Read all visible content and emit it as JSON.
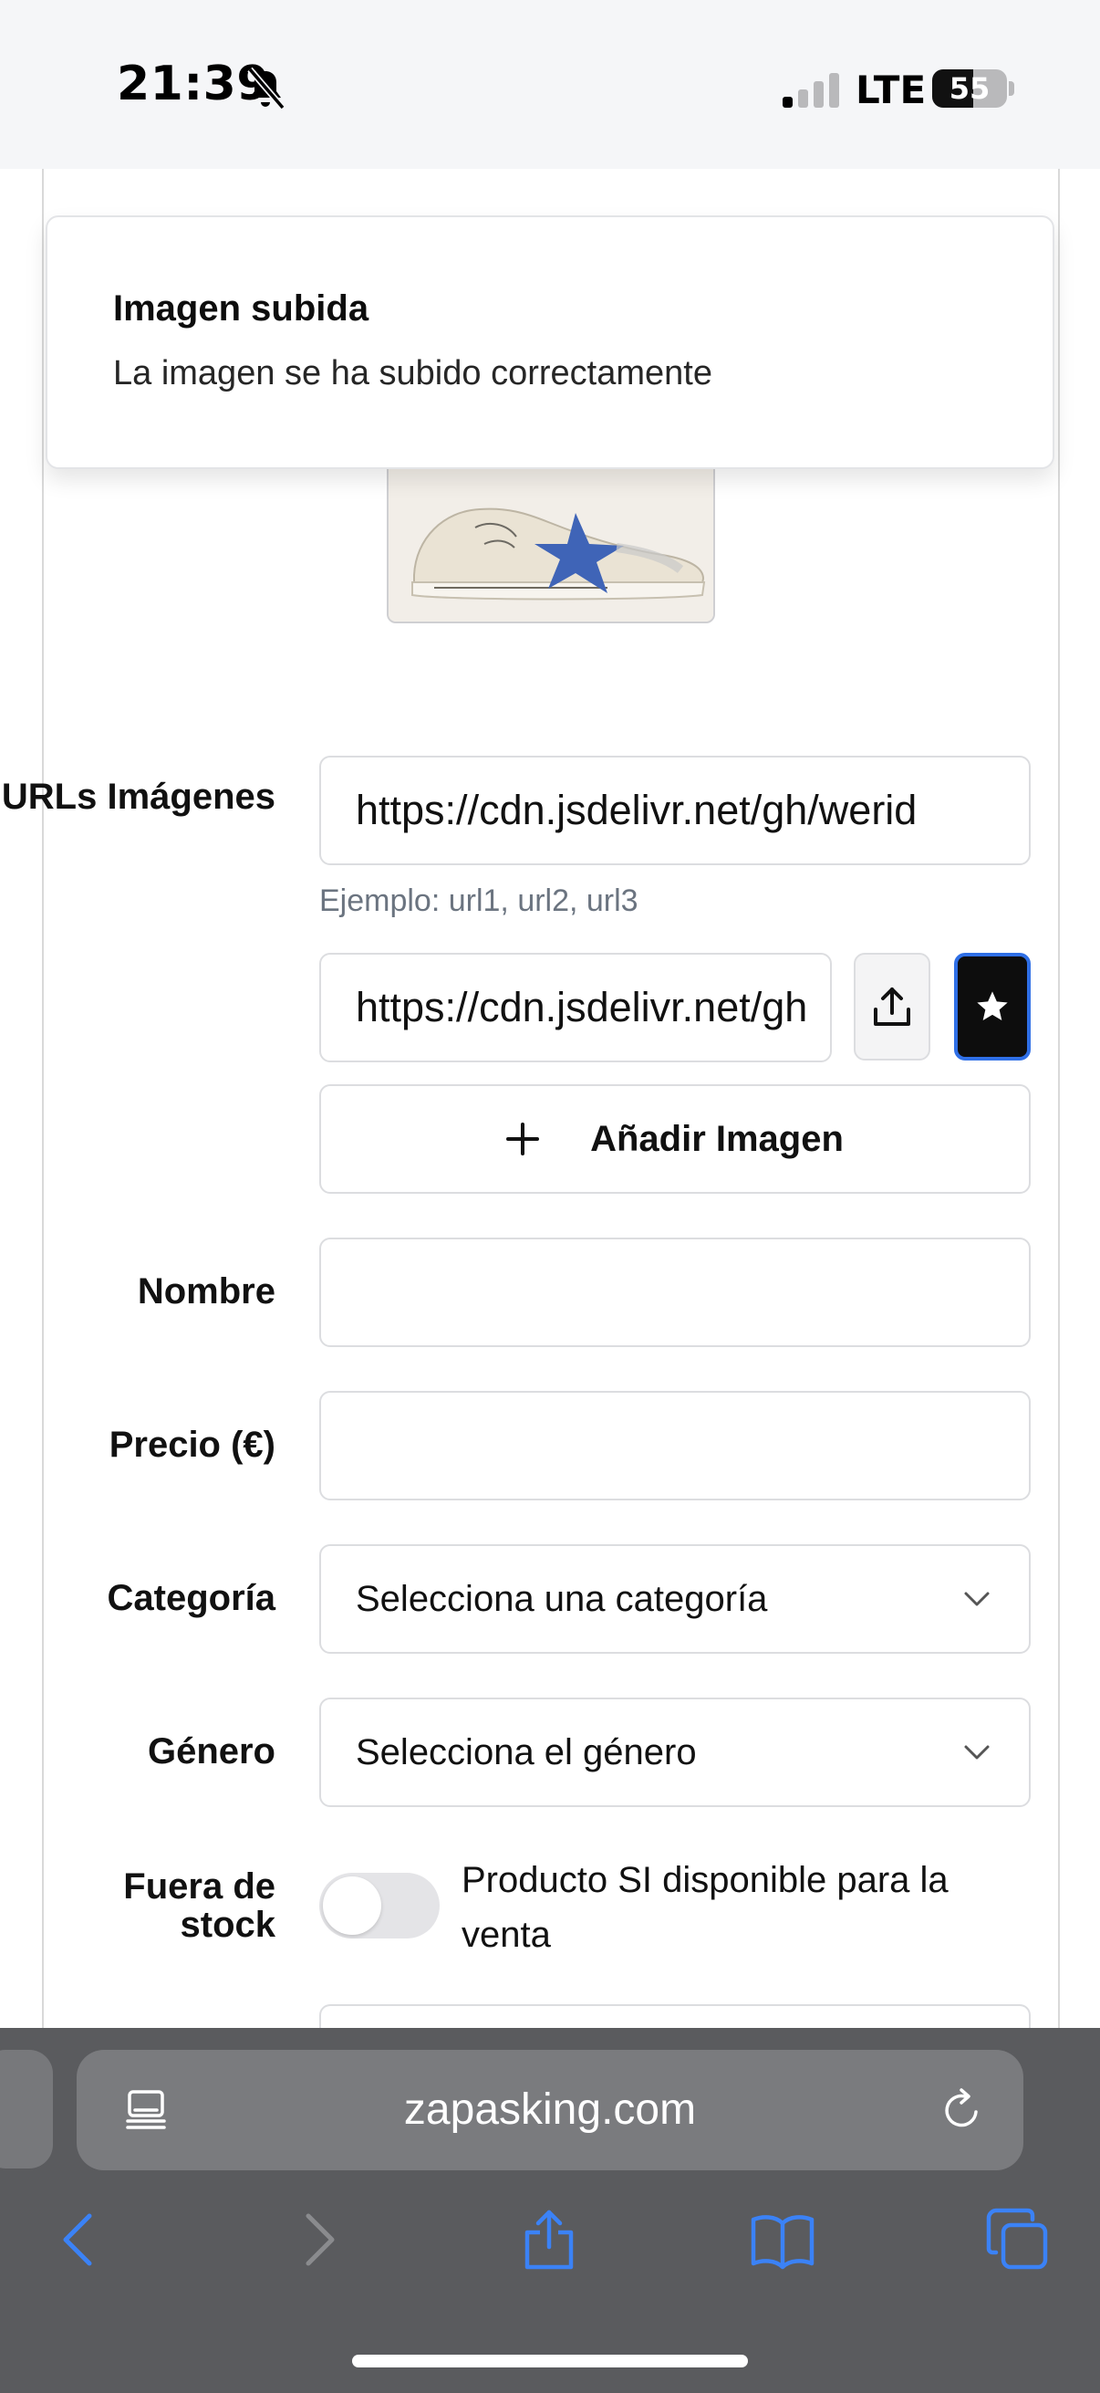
{
  "status_bar": {
    "time": "21:39",
    "network": "LTE",
    "battery_level": "55",
    "battery_fraction": 0.55,
    "icons": [
      "bell-slash-icon",
      "cellular-signal-icon",
      "battery-icon"
    ]
  },
  "toast": {
    "title": "Imagen subida",
    "description": "La imagen se ha subido correctamente"
  },
  "form": {
    "urls_label": "URLs Imágenes",
    "urls_value": "https://cdn.jsdelivr.net/gh/werid",
    "urls_hint": "Ejemplo: url1, url2, url3",
    "image_url_value": "https://cdn.jsdelivr.net/gh",
    "add_image_label": "Añadir Imagen",
    "name_label": "Nombre",
    "name_value": "",
    "price_label": "Precio (€)",
    "price_value": "",
    "category_label": "Categoría",
    "category_selected": "Selecciona una categoría",
    "gender_label": "Género",
    "gender_selected": "Selecciona el género",
    "stock_label": "Fuera de stock",
    "stock_toggle_on": false,
    "stock_toggle_text": "Producto SI disponible para la venta"
  },
  "safari": {
    "url": "zapasking.com",
    "icons": [
      "reader-icon",
      "reload-icon",
      "back-icon",
      "forward-icon",
      "share-icon",
      "bookmarks-icon",
      "tabs-icon"
    ]
  },
  "colors": {
    "accent": "#2f6fe6",
    "toolbar_bg": "#5a5b5e",
    "safari_icon": "#3b82f6"
  }
}
